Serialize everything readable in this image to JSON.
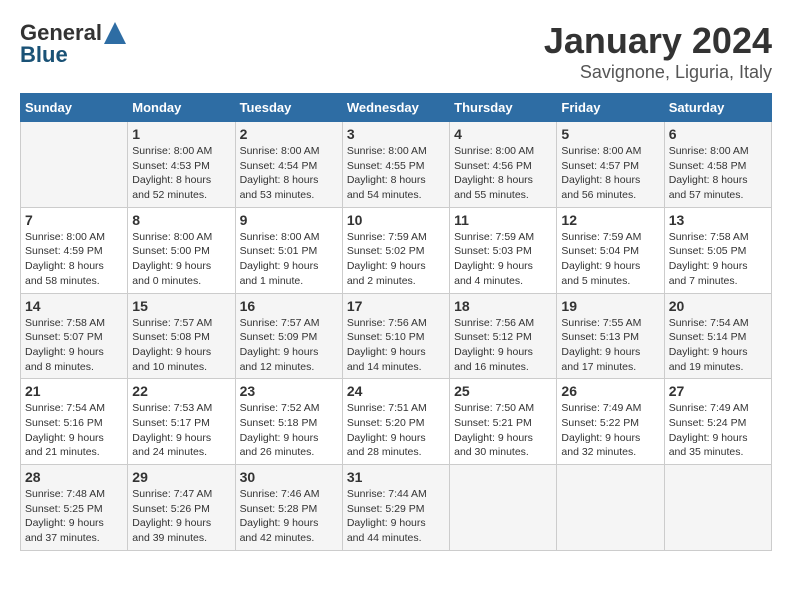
{
  "header": {
    "logo_general": "General",
    "logo_blue": "Blue",
    "month_title": "January 2024",
    "location": "Savignone, Liguria, Italy"
  },
  "columns": [
    "Sunday",
    "Monday",
    "Tuesday",
    "Wednesday",
    "Thursday",
    "Friday",
    "Saturday"
  ],
  "weeks": [
    [
      {
        "day": "",
        "sunrise": "",
        "sunset": "",
        "daylight": ""
      },
      {
        "day": "1",
        "sunrise": "Sunrise: 8:00 AM",
        "sunset": "Sunset: 4:53 PM",
        "daylight": "Daylight: 8 hours and 52 minutes."
      },
      {
        "day": "2",
        "sunrise": "Sunrise: 8:00 AM",
        "sunset": "Sunset: 4:54 PM",
        "daylight": "Daylight: 8 hours and 53 minutes."
      },
      {
        "day": "3",
        "sunrise": "Sunrise: 8:00 AM",
        "sunset": "Sunset: 4:55 PM",
        "daylight": "Daylight: 8 hours and 54 minutes."
      },
      {
        "day": "4",
        "sunrise": "Sunrise: 8:00 AM",
        "sunset": "Sunset: 4:56 PM",
        "daylight": "Daylight: 8 hours and 55 minutes."
      },
      {
        "day": "5",
        "sunrise": "Sunrise: 8:00 AM",
        "sunset": "Sunset: 4:57 PM",
        "daylight": "Daylight: 8 hours and 56 minutes."
      },
      {
        "day": "6",
        "sunrise": "Sunrise: 8:00 AM",
        "sunset": "Sunset: 4:58 PM",
        "daylight": "Daylight: 8 hours and 57 minutes."
      }
    ],
    [
      {
        "day": "7",
        "sunrise": "Sunrise: 8:00 AM",
        "sunset": "Sunset: 4:59 PM",
        "daylight": "Daylight: 8 hours and 58 minutes."
      },
      {
        "day": "8",
        "sunrise": "Sunrise: 8:00 AM",
        "sunset": "Sunset: 5:00 PM",
        "daylight": "Daylight: 9 hours and 0 minutes."
      },
      {
        "day": "9",
        "sunrise": "Sunrise: 8:00 AM",
        "sunset": "Sunset: 5:01 PM",
        "daylight": "Daylight: 9 hours and 1 minute."
      },
      {
        "day": "10",
        "sunrise": "Sunrise: 7:59 AM",
        "sunset": "Sunset: 5:02 PM",
        "daylight": "Daylight: 9 hours and 2 minutes."
      },
      {
        "day": "11",
        "sunrise": "Sunrise: 7:59 AM",
        "sunset": "Sunset: 5:03 PM",
        "daylight": "Daylight: 9 hours and 4 minutes."
      },
      {
        "day": "12",
        "sunrise": "Sunrise: 7:59 AM",
        "sunset": "Sunset: 5:04 PM",
        "daylight": "Daylight: 9 hours and 5 minutes."
      },
      {
        "day": "13",
        "sunrise": "Sunrise: 7:58 AM",
        "sunset": "Sunset: 5:05 PM",
        "daylight": "Daylight: 9 hours and 7 minutes."
      }
    ],
    [
      {
        "day": "14",
        "sunrise": "Sunrise: 7:58 AM",
        "sunset": "Sunset: 5:07 PM",
        "daylight": "Daylight: 9 hours and 8 minutes."
      },
      {
        "day": "15",
        "sunrise": "Sunrise: 7:57 AM",
        "sunset": "Sunset: 5:08 PM",
        "daylight": "Daylight: 9 hours and 10 minutes."
      },
      {
        "day": "16",
        "sunrise": "Sunrise: 7:57 AM",
        "sunset": "Sunset: 5:09 PM",
        "daylight": "Daylight: 9 hours and 12 minutes."
      },
      {
        "day": "17",
        "sunrise": "Sunrise: 7:56 AM",
        "sunset": "Sunset: 5:10 PM",
        "daylight": "Daylight: 9 hours and 14 minutes."
      },
      {
        "day": "18",
        "sunrise": "Sunrise: 7:56 AM",
        "sunset": "Sunset: 5:12 PM",
        "daylight": "Daylight: 9 hours and 16 minutes."
      },
      {
        "day": "19",
        "sunrise": "Sunrise: 7:55 AM",
        "sunset": "Sunset: 5:13 PM",
        "daylight": "Daylight: 9 hours and 17 minutes."
      },
      {
        "day": "20",
        "sunrise": "Sunrise: 7:54 AM",
        "sunset": "Sunset: 5:14 PM",
        "daylight": "Daylight: 9 hours and 19 minutes."
      }
    ],
    [
      {
        "day": "21",
        "sunrise": "Sunrise: 7:54 AM",
        "sunset": "Sunset: 5:16 PM",
        "daylight": "Daylight: 9 hours and 21 minutes."
      },
      {
        "day": "22",
        "sunrise": "Sunrise: 7:53 AM",
        "sunset": "Sunset: 5:17 PM",
        "daylight": "Daylight: 9 hours and 24 minutes."
      },
      {
        "day": "23",
        "sunrise": "Sunrise: 7:52 AM",
        "sunset": "Sunset: 5:18 PM",
        "daylight": "Daylight: 9 hours and 26 minutes."
      },
      {
        "day": "24",
        "sunrise": "Sunrise: 7:51 AM",
        "sunset": "Sunset: 5:20 PM",
        "daylight": "Daylight: 9 hours and 28 minutes."
      },
      {
        "day": "25",
        "sunrise": "Sunrise: 7:50 AM",
        "sunset": "Sunset: 5:21 PM",
        "daylight": "Daylight: 9 hours and 30 minutes."
      },
      {
        "day": "26",
        "sunrise": "Sunrise: 7:49 AM",
        "sunset": "Sunset: 5:22 PM",
        "daylight": "Daylight: 9 hours and 32 minutes."
      },
      {
        "day": "27",
        "sunrise": "Sunrise: 7:49 AM",
        "sunset": "Sunset: 5:24 PM",
        "daylight": "Daylight: 9 hours and 35 minutes."
      }
    ],
    [
      {
        "day": "28",
        "sunrise": "Sunrise: 7:48 AM",
        "sunset": "Sunset: 5:25 PM",
        "daylight": "Daylight: 9 hours and 37 minutes."
      },
      {
        "day": "29",
        "sunrise": "Sunrise: 7:47 AM",
        "sunset": "Sunset: 5:26 PM",
        "daylight": "Daylight: 9 hours and 39 minutes."
      },
      {
        "day": "30",
        "sunrise": "Sunrise: 7:46 AM",
        "sunset": "Sunset: 5:28 PM",
        "daylight": "Daylight: 9 hours and 42 minutes."
      },
      {
        "day": "31",
        "sunrise": "Sunrise: 7:44 AM",
        "sunset": "Sunset: 5:29 PM",
        "daylight": "Daylight: 9 hours and 44 minutes."
      },
      {
        "day": "",
        "sunrise": "",
        "sunset": "",
        "daylight": ""
      },
      {
        "day": "",
        "sunrise": "",
        "sunset": "",
        "daylight": ""
      },
      {
        "day": "",
        "sunrise": "",
        "sunset": "",
        "daylight": ""
      }
    ]
  ]
}
